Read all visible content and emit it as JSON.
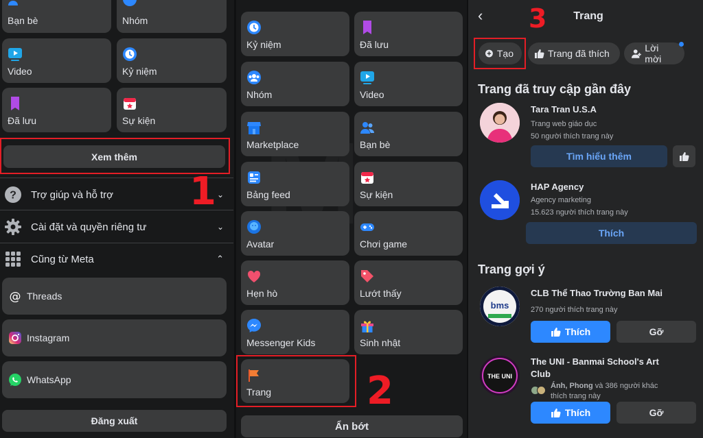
{
  "left": {
    "tiles": [
      {
        "label": "Bạn bè",
        "icon": "friends-icon"
      },
      {
        "label": "Nhóm",
        "icon": "groups-icon"
      },
      {
        "label": "Video",
        "icon": "video-icon"
      },
      {
        "label": "Kỷ niệm",
        "icon": "memories-icon"
      },
      {
        "label": "Đã lưu",
        "icon": "saved-icon"
      },
      {
        "label": "Sự kiện",
        "icon": "events-icon"
      }
    ],
    "see_more": "Xem thêm",
    "help": "Trợ giúp và hỗ trợ",
    "settings": "Cài đặt và quyền riêng tư",
    "meta": "Cũng từ Meta",
    "apps": [
      "Threads",
      "Instagram",
      "WhatsApp"
    ],
    "logout": "Đăng xuất"
  },
  "middle": {
    "tiles": [
      {
        "label": "Kỷ niệm"
      },
      {
        "label": "Đã lưu"
      },
      {
        "label": "Nhóm"
      },
      {
        "label": "Video"
      },
      {
        "label": "Marketplace"
      },
      {
        "label": "Bạn bè"
      },
      {
        "label": "Bảng feed"
      },
      {
        "label": "Sự kiện"
      },
      {
        "label": "Avatar"
      },
      {
        "label": "Chơi game"
      },
      {
        "label": "Hẹn hò"
      },
      {
        "label": "Lướt thấy"
      },
      {
        "label": "Messenger Kids"
      },
      {
        "label": "Sinh nhật"
      },
      {
        "label": "Trang"
      }
    ],
    "hide_less": "Ẩn bớt"
  },
  "right": {
    "title": "Trang",
    "chips": {
      "create": "Tạo",
      "liked": "Trang đã thích",
      "invites": "Lời mời"
    },
    "recent_title": "Trang đã truy cập gần đây",
    "recent": [
      {
        "name": "Tara Tran U.S.A",
        "type": "Trang web giáo dục",
        "likes": "50 người thích trang này",
        "action": "Tìm hiểu thêm"
      },
      {
        "name": "HAP Agency",
        "type": "Agency marketing",
        "likes": "15.623 người thích trang này",
        "action": "Thích"
      }
    ],
    "suggest_title": "Trang gợi ý",
    "suggest": [
      {
        "name": "CLB Thể Thao Trường Ban Mai",
        "likes": "270 người thích trang này",
        "like": "Thích",
        "remove": "Gỡ",
        "logo": "bms"
      },
      {
        "name1": "The UNI - Banmai School's Art",
        "name2": "Club",
        "friends_bold": "Ánh, Phong",
        "friends_rest": " và 386 người khác",
        "likes2": "thích trang này",
        "like": "Thích",
        "remove": "Gỡ",
        "logo": "THE UNI"
      }
    ]
  },
  "steps": [
    "1",
    "2",
    "3"
  ],
  "colors": {
    "accent_red": "#e41e26",
    "fb_blue": "#2d88ff",
    "tile_bg": "#3a3b3c"
  }
}
